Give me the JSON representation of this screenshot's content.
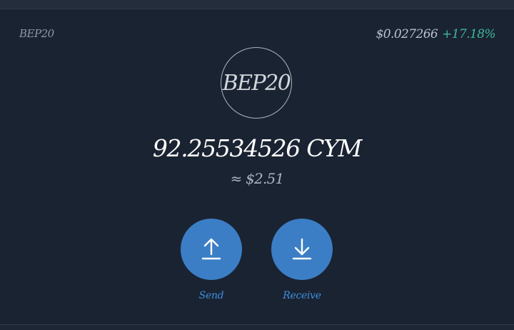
{
  "header": {
    "network_label": "BEP20",
    "price": "$0.027266",
    "price_change": "+17.18%"
  },
  "token": {
    "logo_text": "BEP20",
    "balance": "92.25534526 CYM",
    "fiat_value": "≈ $2.51"
  },
  "actions": {
    "send_label": "Send",
    "receive_label": "Receive"
  },
  "icons": {
    "send": "arrow-up-icon",
    "receive": "arrow-down-icon"
  },
  "colors": {
    "background": "#1a2332",
    "accent": "#3b7ec6",
    "positive": "#3fb99b"
  }
}
